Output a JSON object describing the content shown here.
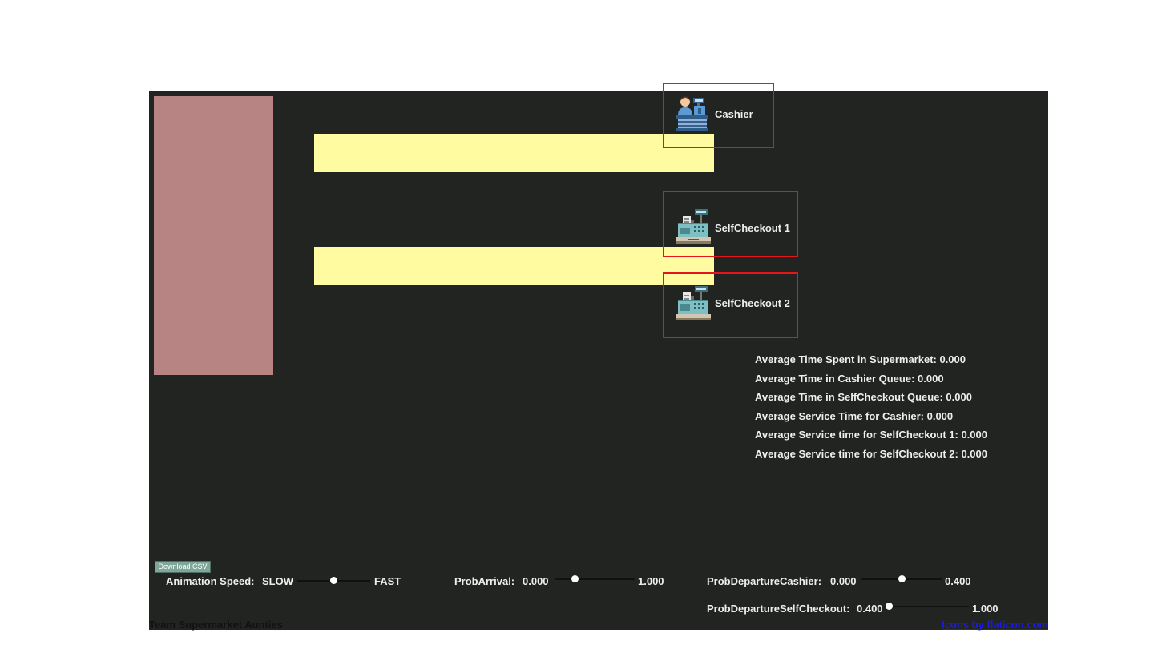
{
  "stations": {
    "cashier": {
      "label": "Cashier",
      "icon": "cashier-person-icon"
    },
    "self1": {
      "label": "SelfCheckout 1",
      "icon": "self-checkout-machine-icon"
    },
    "self2": {
      "label": "SelfCheckout 2",
      "icon": "self-checkout-machine-icon"
    }
  },
  "stats": [
    "Average Time Spent in Supermarket: 0.000",
    "Average Time in Cashier Queue: 0.000",
    "Average Time in SelfCheckout Queue: 0.000",
    "Average Service Time for Cashier: 0.000",
    "Average Service time for SelfCheckout 1: 0.000",
    "Average Service time for SelfCheckout 2: 0.000"
  ],
  "controls": {
    "download_label": "Download CSV",
    "speed": {
      "label": "Animation Speed:",
      "min": "SLOW",
      "max": "FAST",
      "value": 0.5
    },
    "arrival": {
      "label": "ProbArrival:",
      "min": "0.000",
      "max": "1.000",
      "value": 0.25
    },
    "cashier_dep": {
      "label": "ProbDepartureCashier:",
      "min": "0.000",
      "max": "0.400",
      "value": 0.5
    },
    "self_dep": {
      "label": "ProbDepartureSelfCheckout:",
      "min": "0.400",
      "max": "1.000",
      "value": 0.0
    }
  },
  "footer": {
    "team": "Team Supermarket Aunties",
    "credit": "Icons by flaticon.com"
  },
  "colors": {
    "background": "#212421",
    "entrance": "#b78483",
    "queue": "#fefba0",
    "highlight": "#e8141c"
  }
}
